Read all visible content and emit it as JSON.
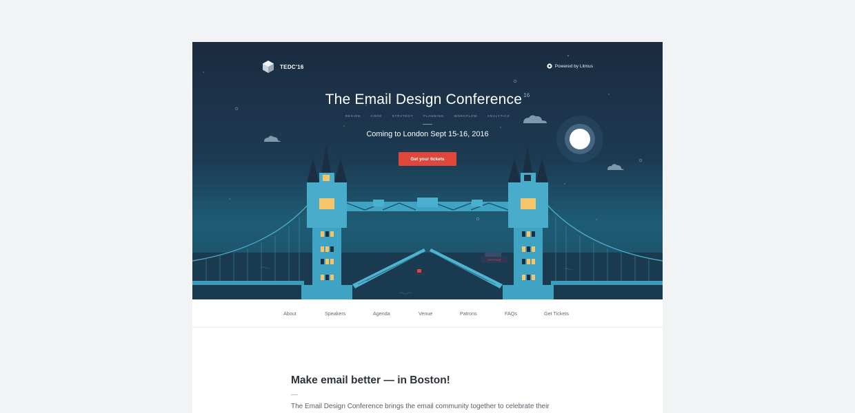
{
  "brand": {
    "logo_text": "TEDC'16",
    "powered_by": "Powered by Litmus"
  },
  "hero": {
    "title": "The Email Design Conference",
    "title_sup": "16",
    "tags": [
      "DESIGN",
      "·",
      "CODE",
      "·",
      "STRATEGY",
      "·",
      "PLANNING",
      "·",
      "WORKFLOW",
      "·",
      "ANALYTICS"
    ],
    "subtitle": "Coming to London Sept 15-16, 2016",
    "cta_label": "Get your tickets",
    "boat_label": "REEF-RMR"
  },
  "nav": {
    "items": [
      "About",
      "Speakers",
      "Agenda",
      "Venue",
      "Patrons",
      "FAQs",
      "Get Tickets"
    ]
  },
  "intro": {
    "heading": "Make email better — in Boston!",
    "text": "The Email Design Conference brings the email community together to celebrate their"
  },
  "colors": {
    "background": "#f2f3f5",
    "hero_top": "#1b2b40",
    "hero_bottom": "#1e5c74",
    "tower": "#3fa3c4",
    "cta": "#e0473a",
    "window_lit": "#f6c56a"
  }
}
